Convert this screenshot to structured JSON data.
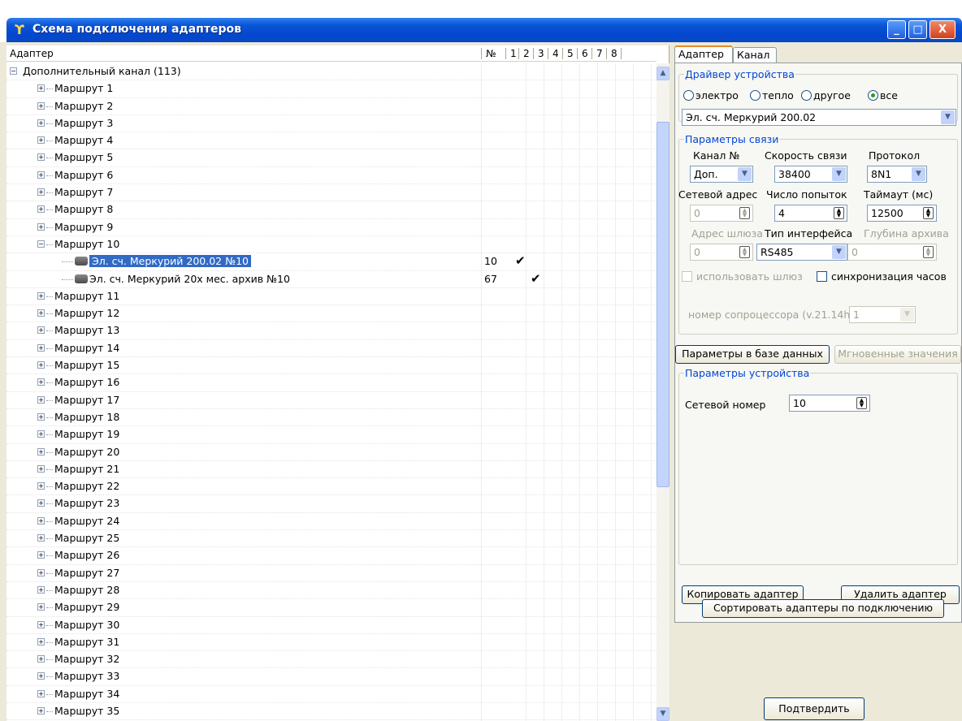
{
  "window": {
    "title": "Схема подключения адаптеров",
    "controls": {
      "minimize": "_",
      "maximize": "□",
      "close": "X"
    }
  },
  "tree": {
    "columns": {
      "adapter": "Адаптер",
      "num": "№",
      "c1": "1",
      "c2": "2",
      "c3": "3",
      "c4": "4",
      "c5": "5",
      "c6": "6",
      "c7": "7",
      "c8": "8"
    },
    "root": "Дополнительный канал (113)",
    "routes_before": [
      "Маршрут 1",
      "Маршрут 2",
      "Маршрут 3",
      "Маршрут 4",
      "Маршрут 5",
      "Маршрут 6",
      "Маршрут 7",
      "Маршрут 8",
      "Маршрут 9"
    ],
    "expanded_route": "Маршрут 10",
    "devices": [
      {
        "label": "Эл. сч. Меркурий 200.02 №10",
        "num": "10",
        "checked_col": 1,
        "selected": true
      },
      {
        "label": "Эл. сч. Меркурий 20х мес. архив №10",
        "num": "67",
        "checked_col": 2,
        "selected": false
      }
    ],
    "routes_after": [
      "Маршрут 11",
      "Маршрут 12",
      "Маршрут 13",
      "Маршрут 14",
      "Маршрут 15",
      "Маршрут 16",
      "Маршрут 17",
      "Маршрут 18",
      "Маршрут 19",
      "Маршрут 20",
      "Маршрут 21",
      "Маршрут 22",
      "Маршрут 23",
      "Маршрут 24",
      "Маршрут 25",
      "Маршрут 26",
      "Маршрут 27",
      "Маршрут 28",
      "Маршрут 29",
      "Маршрут 30",
      "Маршрут 31",
      "Маршрут 32",
      "Маршрут 33",
      "Маршрут 34",
      "Маршрут 35"
    ]
  },
  "tabs": {
    "adapter": "Адаптер",
    "channel": "Канал"
  },
  "driver": {
    "legend": "Драйвер устройства",
    "radios": {
      "electro": "электро",
      "heat": "тепло",
      "other": "другое",
      "all": "все"
    },
    "selected_radio": "все",
    "device_select": "Эл. сч. Меркурий 200.02"
  },
  "link": {
    "legend": "Параметры связи",
    "channel_label": "Канал №",
    "channel_value": "Доп.",
    "speed_label": "Скорость связи",
    "speed_value": "38400",
    "protocol_label": "Протокол",
    "protocol_value": "8N1",
    "net_address_label": "Сетевой адрес",
    "net_address_value": "0",
    "attempts_label": "Число попыток",
    "attempts_value": "4",
    "timeout_label": "Таймаут (мс)",
    "timeout_value": "12500",
    "gateway_address_label": "Адрес шлюза",
    "gateway_address_value": "0",
    "interface_label": "Тип интерфейса",
    "interface_value": "RS485",
    "archive_depth_label": "Глубина архива",
    "archive_depth_value": "0",
    "use_gateway_label": "использовать шлюз",
    "sync_clock_label": "синхронизация часов",
    "coprocessor_label": "номер сопроцессора (v.21.14h):",
    "coprocessor_value": "1"
  },
  "buttons": {
    "db_params": "Параметры в базе данных",
    "instant_values": "Мгновенные значения",
    "copy_adapter": "Копировать адаптер",
    "delete_adapter": "Удалить адаптер",
    "sort_adapters": "Сортировать адаптеры по подключению",
    "confirm": "Подтвердить"
  },
  "device_params": {
    "legend": "Параметры устройства",
    "net_number_label": "Сетевой номер",
    "net_number_value": "10"
  }
}
